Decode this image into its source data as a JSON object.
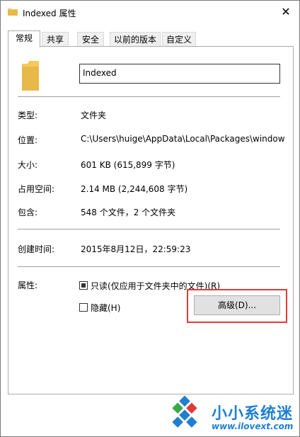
{
  "window": {
    "title": "Indexed 属性",
    "close_glyph": "✕"
  },
  "tabs": [
    {
      "label": "常规",
      "active": true
    },
    {
      "label": "共享"
    },
    {
      "label": "安全"
    },
    {
      "label": "以前的版本"
    },
    {
      "label": "自定义"
    }
  ],
  "general": {
    "name": "Indexed",
    "rows": [
      {
        "label": "类型:",
        "value": "文件夹"
      },
      {
        "label": "位置:",
        "value": "C:\\Users\\huige\\AppData\\Local\\Packages\\window"
      },
      {
        "label": "大小:",
        "value": "601 KB (615,899 字节)"
      },
      {
        "label": "占用空间:",
        "value": "2.14 MB (2,244,608 字节)"
      },
      {
        "label": "包含:",
        "value": "548 个文件，2 个文件夹"
      }
    ],
    "created": {
      "label": "创建时间:",
      "value": "2015年8月12日，22:59:23"
    },
    "attributes": {
      "label": "属性:",
      "readonly": "只读(仅应用于文件夹中的文件)(R)",
      "hidden": "隐藏(H)",
      "advanced_button": "高级(D)..."
    }
  },
  "watermark": {
    "name": "小小系统迷",
    "url": "www.ilovext.com"
  },
  "colors": {
    "highlight": "#e03b3b",
    "folder": "#f4c95d",
    "watermark": "#1f7fd1"
  }
}
